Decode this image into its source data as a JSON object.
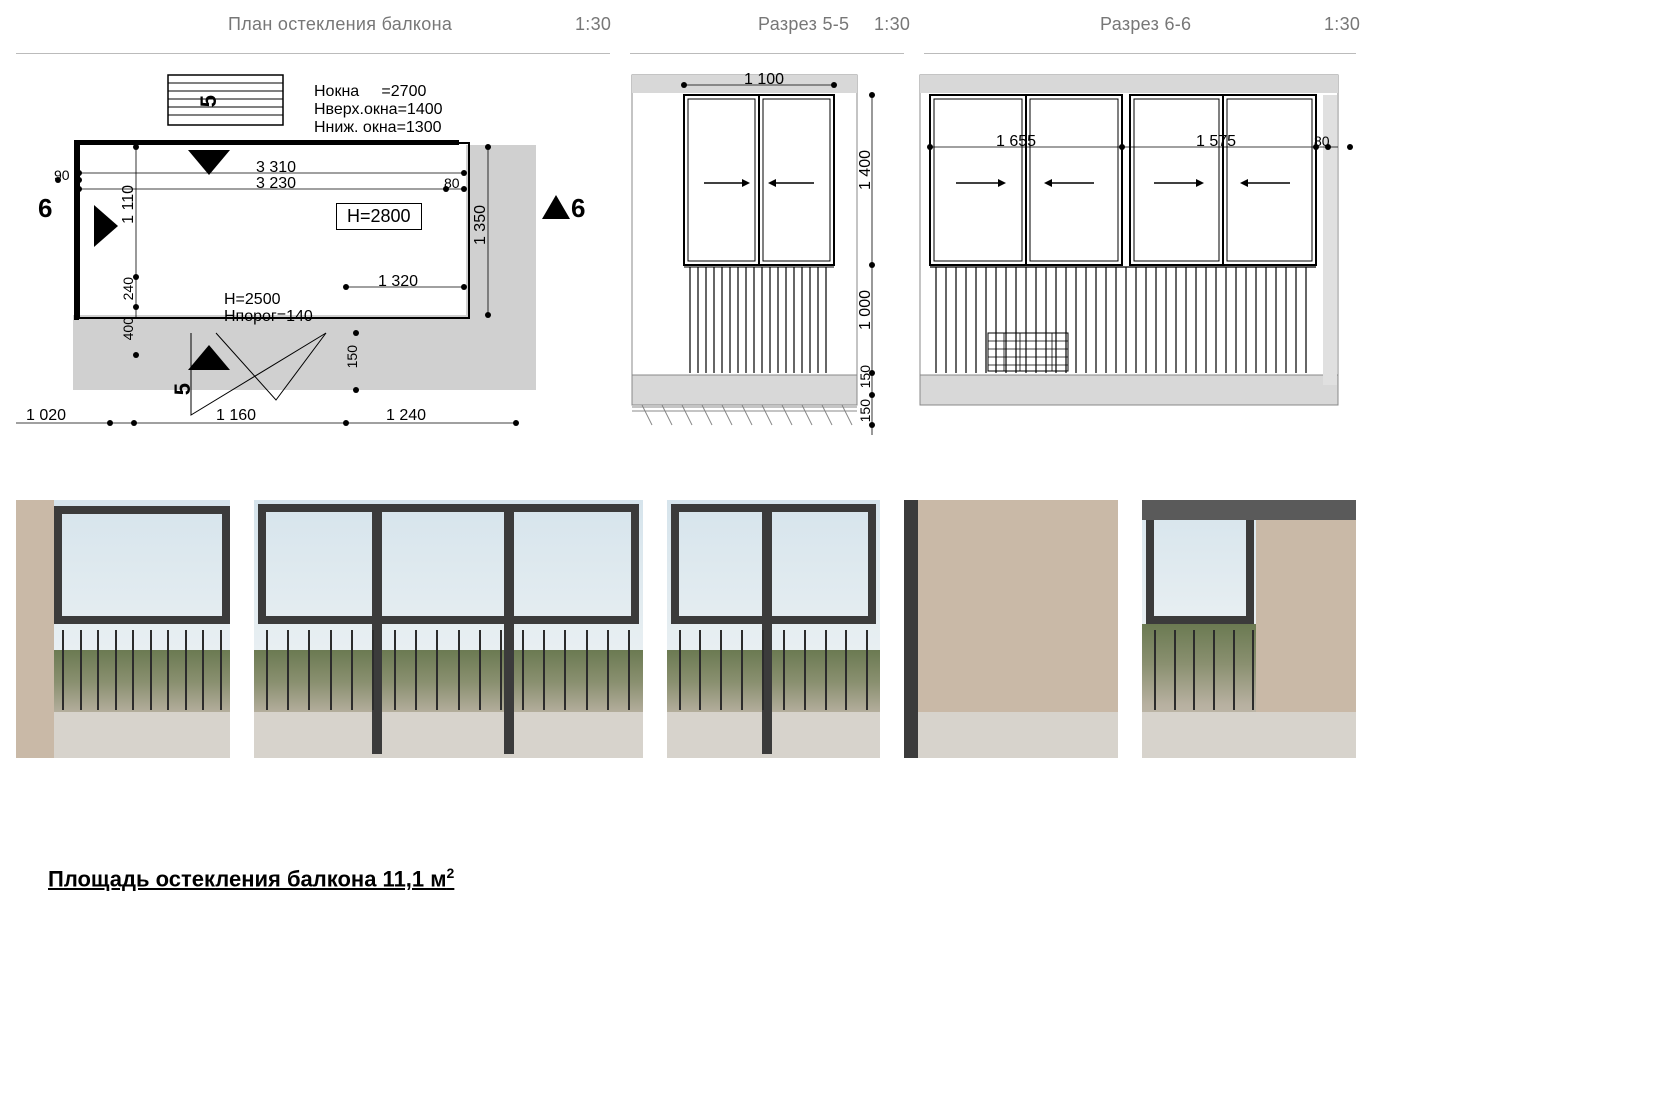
{
  "headers": {
    "plan_title": "План остекления балкона",
    "plan_scale": "1:30",
    "sec5_title": "Разрез 5-5",
    "sec5_scale": "1:30",
    "sec6_title": "Разрез 6-6",
    "sec6_scale": "1:30"
  },
  "plan": {
    "params": {
      "h_okna_label": "Hокна",
      "h_okna_val": "=2700",
      "h_verh_label": "Hверх.окна",
      "h_verh_val": "=1400",
      "h_nij_label": "Hниж. окна",
      "h_nij_val": "=1300"
    },
    "hbox": "H=2800",
    "sec_left": "6",
    "sec_right": "6",
    "sec_top": "5",
    "sec_bottom": "5",
    "dims": {
      "d90": "90",
      "d3310": "3 310",
      "d3230": "3 230",
      "d80": "80",
      "d1110": "1 110",
      "d240": "240",
      "d400": "400",
      "d1350": "1 350",
      "d1320": "1 320",
      "d1020": "1 020",
      "d1160": "1 160",
      "d1240": "1 240",
      "d150": "150",
      "h2500": "H=2500",
      "hporog": "Hпорог=140"
    }
  },
  "sec5": {
    "d1100": "1 100",
    "d1400": "1 400",
    "d1000": "1 000",
    "d150a": "150",
    "d150b": "150"
  },
  "sec6": {
    "d1655": "1 655",
    "d1575": "1 575",
    "d80": "80"
  },
  "footer_pre": "Площадь остекления балкона 11,1 м",
  "footer_sup": "2"
}
